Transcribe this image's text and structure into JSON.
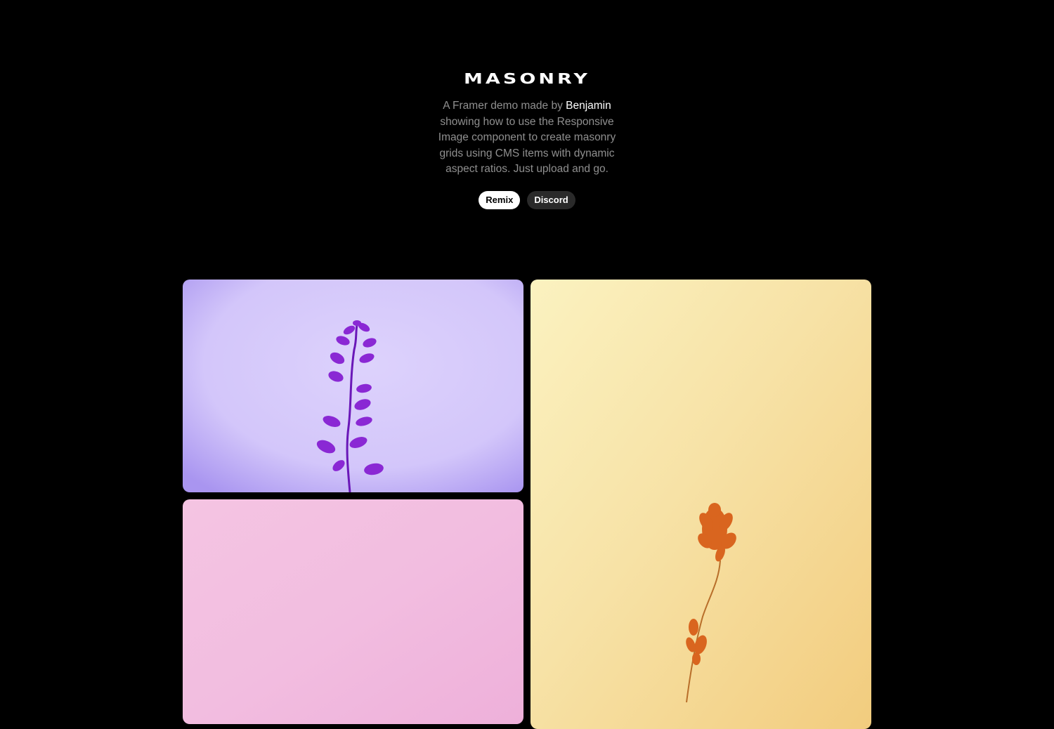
{
  "page": {
    "title": "MASONRY",
    "description_prefix": "A Framer demo made by ",
    "author": "Benjamin",
    "description_suffix": " showing how to use the Responsive Image component to create masonry grids using CMS items with dynamic aspect ratios. Just upload and go."
  },
  "buttons": {
    "remix_label": "Remix",
    "discord_label": "Discord"
  },
  "colors": {
    "background": "#000000",
    "title": "#ffffff",
    "body_text": "#8f8f8f",
    "purple_card": "#d9cdfb",
    "purple_flower": "#7a1fc8",
    "pink_card": "#f2bfe0",
    "yellow_card": "#f7dc98",
    "yellow_flower": "#d9621f"
  },
  "gallery": {
    "items": [
      {
        "icon": "purple-flower-photo"
      },
      {
        "icon": "pink-background-photo"
      },
      {
        "icon": "dried-orange-flower-photo"
      }
    ]
  }
}
